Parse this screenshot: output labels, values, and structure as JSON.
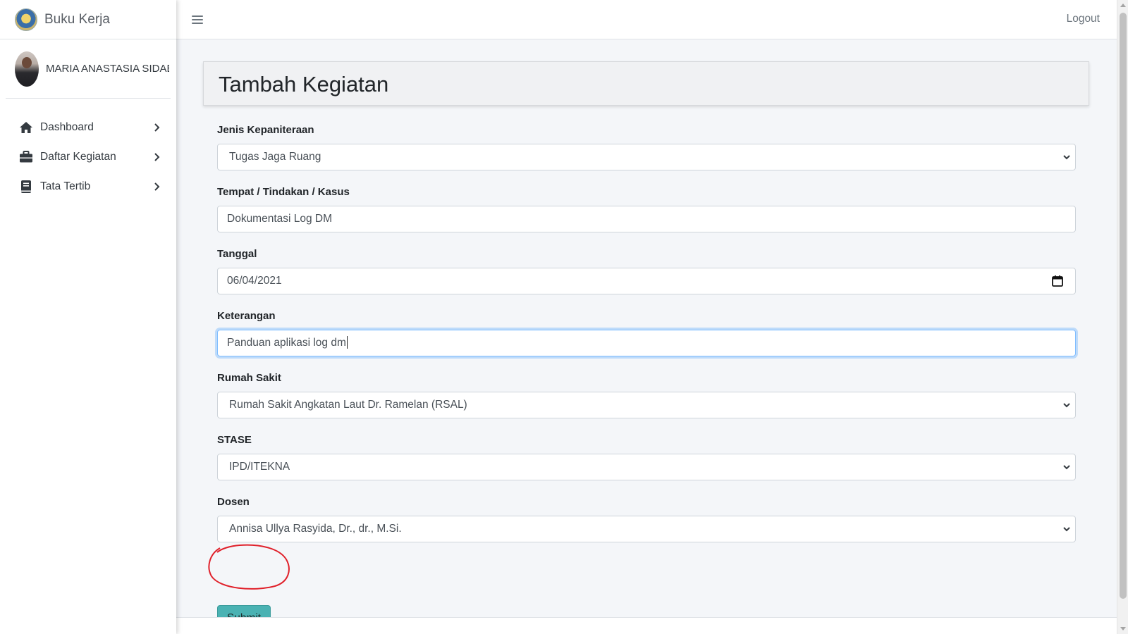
{
  "brand": {
    "name": "Buku Kerja",
    "logo_icon": "university-seal-logo"
  },
  "user": {
    "name": "MARIA ANASTASIA SIDABUTAR"
  },
  "sidebar": {
    "items": [
      {
        "label": "Dashboard",
        "icon": "home-icon"
      },
      {
        "label": "Daftar Kegiatan",
        "icon": "briefcase-icon"
      },
      {
        "label": "Tata Tertib",
        "icon": "book-icon"
      }
    ]
  },
  "topbar": {
    "logout_label": "Logout"
  },
  "page": {
    "title": "Tambah Kegiatan"
  },
  "form": {
    "jenis": {
      "label": "Jenis Kepaniteraan",
      "value": "Tugas Jaga Ruang"
    },
    "tempat": {
      "label": "Tempat / Tindakan / Kasus",
      "value": "Dokumentasi Log DM"
    },
    "tanggal": {
      "label": "Tanggal",
      "value": "06/04/2021"
    },
    "keterangan": {
      "label": "Keterangan",
      "value": "Panduan aplikasi log dm"
    },
    "rumah_sakit": {
      "label": "Rumah Sakit",
      "value": "Rumah Sakit Angkatan Laut Dr. Ramelan (RSAL)"
    },
    "stase": {
      "label": "STASE",
      "value": "IPD/ITEKNA"
    },
    "dosen": {
      "label": "Dosen",
      "value": "Annisa Ullya Rasyida, Dr., dr., M.Si."
    },
    "submit_label": "Submit"
  },
  "colors": {
    "submit_button": "#4ab2b3",
    "annotation_circle": "#e0202a",
    "focus_border": "#80bdff",
    "content_bg": "#f4f6f9"
  }
}
